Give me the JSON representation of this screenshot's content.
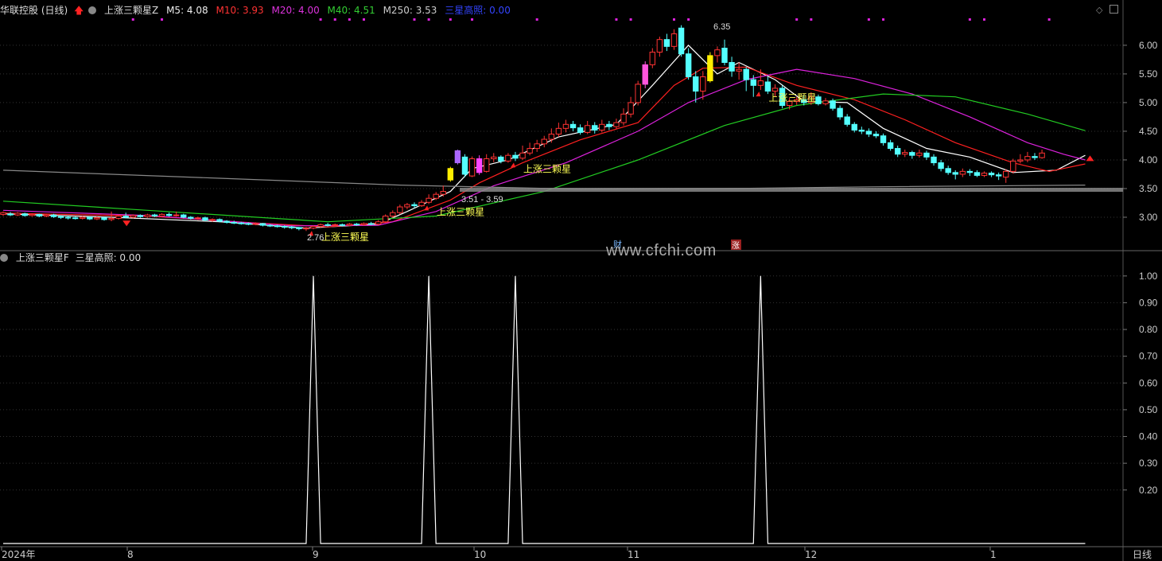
{
  "header_main": {
    "stock": "华联控股 (日线)",
    "indicator": "上涨三颗星Z",
    "m5": "M5: 4.08",
    "m10": "M10: 3.93",
    "m20": "M20: 4.00",
    "m40": "M40: 4.51",
    "m250": "M250: 3.53",
    "signal": "三星高照: 0.00"
  },
  "header_sub": {
    "indicator": "上涨三颗星F",
    "value": "三星高照: 0.00"
  },
  "watermark": "www.cfchi.com",
  "colors": {
    "up": "#ff3333",
    "down": "#54ffff",
    "m5": "#ffffff",
    "m10": "#ff2020",
    "m20": "#dd22dd",
    "m40": "#22cc22",
    "m250": "#888888",
    "label": "#ffff55"
  },
  "chart_data": {
    "type": "candlestick",
    "price_axis": {
      "ticks": [
        "6.00",
        "5.50",
        "5.00",
        "4.50",
        "4.00",
        "3.50",
        "3.00"
      ],
      "ylim": [
        2.5,
        6.5
      ]
    },
    "time_axis": {
      "labels": [
        "2024年",
        "8",
        "9",
        "10",
        "11",
        "12",
        "1"
      ],
      "period": "日线"
    },
    "annotations": {
      "high": "6.35",
      "low": "2.76",
      "range": "3.51 - 3.59",
      "signal_label": "上涨三颗星",
      "badge_cai": "财",
      "badge_zhang": "涨"
    },
    "candles": [
      [
        3.05,
        3.08,
        3.02,
        3.1
      ],
      [
        3.06,
        3.04,
        3.02,
        3.09
      ],
      [
        3.04,
        3.07,
        3.02,
        3.09
      ],
      [
        3.06,
        3.03,
        3.01,
        3.08
      ],
      [
        3.03,
        3.05,
        3.01,
        3.07
      ],
      [
        3.05,
        3.02,
        3.0,
        3.06
      ],
      [
        3.02,
        3.04,
        3.0,
        3.06
      ],
      [
        3.04,
        3.01,
        2.99,
        3.06
      ],
      [
        3.01,
        3.0,
        2.97,
        3.03
      ],
      [
        3.0,
        2.99,
        2.96,
        3.02
      ],
      [
        2.99,
        2.98,
        2.96,
        3.01
      ],
      [
        2.98,
        3.0,
        2.96,
        3.02
      ],
      [
        3.0,
        2.97,
        2.95,
        3.01
      ],
      [
        2.97,
        2.99,
        2.95,
        3.01
      ],
      [
        2.99,
        2.96,
        2.94,
        3.0
      ],
      [
        2.96,
        2.98,
        2.93,
        3.1
      ],
      [
        2.98,
        3.02,
        2.96,
        3.05
      ],
      [
        3.02,
        3.0,
        2.98,
        3.08
      ],
      [
        3.0,
        3.03,
        2.98,
        3.05
      ],
      [
        3.03,
        3.01,
        2.99,
        3.05
      ],
      [
        3.01,
        3.04,
        2.99,
        3.06
      ],
      [
        3.04,
        3.02,
        3.0,
        3.06
      ],
      [
        3.02,
        3.05,
        3.0,
        3.07
      ],
      [
        3.05,
        3.03,
        3.01,
        3.08
      ],
      [
        3.03,
        3.04,
        3.01,
        3.1
      ],
      [
        3.04,
        3.0,
        2.98,
        3.06
      ],
      [
        3.0,
        2.98,
        2.96,
        3.02
      ],
      [
        2.98,
        2.99,
        2.95,
        3.01
      ],
      [
        2.99,
        2.95,
        2.93,
        3.01
      ],
      [
        2.95,
        2.96,
        2.92,
        2.98
      ],
      [
        2.96,
        2.93,
        2.91,
        2.98
      ],
      [
        2.93,
        2.91,
        2.89,
        2.95
      ],
      [
        2.91,
        2.9,
        2.88,
        2.94
      ],
      [
        2.9,
        2.89,
        2.87,
        2.92
      ],
      [
        2.89,
        2.88,
        2.86,
        2.91
      ],
      [
        2.88,
        2.89,
        2.86,
        2.91
      ],
      [
        2.89,
        2.86,
        2.84,
        2.9
      ],
      [
        2.86,
        2.85,
        2.83,
        2.88
      ],
      [
        2.85,
        2.84,
        2.82,
        2.87
      ],
      [
        2.84,
        2.83,
        2.8,
        2.86
      ],
      [
        2.83,
        2.82,
        2.79,
        2.85
      ],
      [
        2.82,
        2.8,
        2.77,
        2.83
      ],
      [
        2.8,
        2.81,
        2.76,
        2.83
      ],
      [
        2.81,
        2.84,
        2.79,
        2.86
      ],
      [
        2.84,
        2.87,
        2.82,
        2.89
      ],
      [
        2.87,
        2.86,
        2.84,
        2.9
      ],
      [
        2.86,
        2.87,
        2.84,
        2.89
      ],
      [
        2.87,
        2.86,
        2.84,
        2.89
      ],
      [
        2.86,
        2.88,
        2.84,
        2.9
      ],
      [
        2.88,
        2.87,
        2.85,
        2.9
      ],
      [
        2.87,
        2.89,
        2.85,
        2.91
      ],
      [
        2.89,
        2.88,
        2.86,
        2.92
      ],
      [
        2.88,
        2.92,
        2.86,
        2.95
      ],
      [
        2.92,
        3.02,
        2.9,
        3.05
      ],
      [
        3.02,
        3.08,
        2.99,
        3.12
      ],
      [
        3.08,
        3.18,
        3.05,
        3.22
      ],
      [
        3.18,
        3.22,
        3.14,
        3.25
      ],
      [
        3.22,
        3.2,
        3.16,
        3.26
      ],
      [
        3.2,
        3.26,
        3.18,
        3.3
      ],
      [
        3.26,
        3.33,
        3.23,
        3.4
      ],
      [
        3.33,
        3.4,
        3.3,
        3.44
      ],
      [
        3.4,
        3.45,
        3.36,
        3.55
      ],
      [
        3.65,
        3.85,
        3.62,
        3.88
      ],
      [
        3.95,
        4.16,
        3.92,
        4.18
      ],
      [
        4.05,
        3.75,
        3.7,
        4.1
      ],
      [
        3.72,
        4.02,
        3.7,
        4.06
      ],
      [
        4.02,
        3.78,
        3.74,
        4.08
      ],
      [
        3.8,
        4.02,
        3.78,
        4.1
      ],
      [
        4.02,
        4.05,
        3.96,
        4.12
      ],
      [
        4.05,
        3.98,
        3.94,
        4.08
      ],
      [
        3.98,
        4.08,
        3.95,
        4.12
      ],
      [
        4.08,
        4.03,
        3.98,
        4.14
      ],
      [
        4.03,
        4.12,
        4.0,
        4.25
      ],
      [
        4.12,
        4.2,
        4.08,
        4.3
      ],
      [
        4.2,
        4.28,
        4.14,
        4.35
      ],
      [
        4.28,
        4.36,
        4.22,
        4.42
      ],
      [
        4.36,
        4.45,
        4.3,
        4.55
      ],
      [
        4.45,
        4.55,
        4.4,
        4.65
      ],
      [
        4.55,
        4.62,
        4.48,
        4.7
      ],
      [
        4.62,
        4.56,
        4.5,
        4.68
      ],
      [
        4.56,
        4.48,
        4.44,
        4.62
      ],
      [
        4.48,
        4.6,
        4.45,
        4.68
      ],
      [
        4.6,
        4.52,
        4.46,
        4.66
      ],
      [
        4.52,
        4.62,
        4.48,
        4.7
      ],
      [
        4.62,
        4.58,
        4.52,
        4.68
      ],
      [
        4.58,
        4.65,
        4.54,
        4.72
      ],
      [
        4.65,
        4.8,
        4.6,
        4.9
      ],
      [
        4.8,
        5.0,
        4.74,
        5.1
      ],
      [
        5.0,
        5.32,
        4.95,
        5.38
      ],
      [
        5.32,
        5.66,
        5.25,
        5.72
      ],
      [
        5.66,
        5.88,
        5.6,
        5.95
      ],
      [
        5.88,
        6.1,
        5.8,
        6.15
      ],
      [
        6.1,
        5.98,
        5.9,
        6.2
      ],
      [
        5.98,
        6.2,
        5.92,
        6.28
      ],
      [
        6.3,
        5.85,
        5.8,
        6.35
      ],
      [
        5.85,
        5.45,
        5.4,
        5.95
      ],
      [
        5.45,
        5.2,
        5.0,
        5.55
      ],
      [
        5.2,
        5.45,
        5.05,
        5.55
      ],
      [
        5.38,
        5.82,
        5.35,
        5.88
      ],
      [
        5.82,
        5.92,
        5.7,
        5.98
      ],
      [
        5.95,
        5.7,
        5.65,
        6.1
      ],
      [
        5.7,
        5.55,
        5.45,
        5.8
      ],
      [
        5.55,
        5.58,
        5.4,
        5.7
      ],
      [
        5.58,
        5.4,
        5.2,
        5.62
      ],
      [
        5.4,
        5.3,
        5.1,
        5.48
      ],
      [
        5.3,
        5.38,
        5.22,
        5.58
      ],
      [
        5.36,
        5.2,
        5.15,
        5.45
      ],
      [
        5.2,
        5.25,
        5.1,
        5.32
      ],
      [
        5.25,
        4.95,
        4.9,
        5.3
      ],
      [
        4.95,
        5.02,
        4.88,
        5.08
      ],
      [
        5.02,
        5.05,
        4.96,
        5.1
      ],
      [
        5.05,
        5.0,
        4.95,
        5.12
      ],
      [
        5.0,
        5.1,
        4.96,
        5.18
      ],
      [
        5.1,
        4.98,
        4.95,
        5.14
      ],
      [
        4.98,
        5.03,
        4.95,
        5.08
      ],
      [
        5.03,
        4.9,
        4.86,
        5.07
      ],
      [
        4.9,
        4.75,
        4.7,
        4.95
      ],
      [
        4.75,
        4.62,
        4.58,
        4.8
      ],
      [
        4.62,
        4.52,
        4.48,
        4.66
      ],
      [
        4.52,
        4.5,
        4.45,
        4.58
      ],
      [
        4.5,
        4.45,
        4.4,
        4.55
      ],
      [
        4.45,
        4.42,
        4.38,
        4.5
      ],
      [
        4.42,
        4.3,
        4.25,
        4.46
      ],
      [
        4.3,
        4.2,
        4.16,
        4.35
      ],
      [
        4.2,
        4.1,
        4.05,
        4.25
      ],
      [
        4.1,
        4.13,
        4.05,
        4.18
      ],
      [
        4.13,
        4.08,
        4.02,
        4.16
      ],
      [
        4.08,
        4.12,
        4.04,
        4.18
      ],
      [
        4.12,
        4.05,
        4.0,
        4.16
      ],
      [
        4.05,
        3.95,
        3.9,
        4.1
      ],
      [
        3.95,
        3.85,
        3.8,
        4.0
      ],
      [
        3.85,
        3.78,
        3.74,
        3.9
      ],
      [
        3.78,
        3.75,
        3.66,
        3.82
      ],
      [
        3.75,
        3.8,
        3.7,
        3.85
      ],
      [
        3.8,
        3.78,
        3.72,
        3.84
      ],
      [
        3.78,
        3.73,
        3.7,
        3.82
      ],
      [
        3.73,
        3.77,
        3.7,
        3.8
      ],
      [
        3.77,
        3.74,
        3.7,
        3.8
      ],
      [
        3.74,
        3.72,
        3.65,
        3.78
      ],
      [
        3.7,
        3.8,
        3.6,
        3.84
      ],
      [
        3.8,
        3.98,
        3.76,
        4.02
      ],
      [
        3.98,
        4.0,
        3.94,
        4.1
      ],
      [
        4.0,
        4.06,
        3.96,
        4.14
      ],
      [
        4.06,
        4.04,
        4.0,
        4.12
      ],
      [
        4.04,
        4.12,
        4.02,
        4.18
      ]
    ],
    "ma": {
      "M5": {
        "color": "#ffffff",
        "values": [
          [
            0,
            3.06
          ],
          [
            15,
            3.0
          ],
          [
            30,
            2.92
          ],
          [
            42,
            2.81
          ],
          [
            52,
            2.88
          ],
          [
            56,
            3.1
          ],
          [
            62,
            3.45
          ],
          [
            65,
            3.85
          ],
          [
            70,
            4.0
          ],
          [
            77,
            4.4
          ],
          [
            85,
            4.62
          ],
          [
            90,
            5.3
          ],
          [
            95,
            6.0
          ],
          [
            99,
            5.5
          ],
          [
            102,
            5.7
          ],
          [
            107,
            5.4
          ],
          [
            111,
            5.02
          ],
          [
            117,
            5.0
          ],
          [
            122,
            4.55
          ],
          [
            128,
            4.2
          ],
          [
            134,
            4.05
          ],
          [
            140,
            3.78
          ],
          [
            146,
            3.82
          ],
          [
            150,
            4.08
          ]
        ]
      },
      "M10": {
        "color": "#ff2020",
        "values": [
          [
            0,
            3.07
          ],
          [
            20,
            3.02
          ],
          [
            35,
            2.9
          ],
          [
            45,
            2.83
          ],
          [
            54,
            2.92
          ],
          [
            62,
            3.3
          ],
          [
            66,
            3.6
          ],
          [
            72,
            3.95
          ],
          [
            80,
            4.35
          ],
          [
            88,
            4.65
          ],
          [
            93,
            5.3
          ],
          [
            97,
            5.6
          ],
          [
            103,
            5.62
          ],
          [
            110,
            5.3
          ],
          [
            118,
            5.05
          ],
          [
            125,
            4.7
          ],
          [
            132,
            4.3
          ],
          [
            140,
            3.95
          ],
          [
            145,
            3.8
          ],
          [
            150,
            3.93
          ]
        ]
      },
      "M20": {
        "color": "#dd22dd",
        "values": [
          [
            0,
            3.12
          ],
          [
            20,
            3.03
          ],
          [
            40,
            2.85
          ],
          [
            52,
            2.86
          ],
          [
            60,
            3.1
          ],
          [
            68,
            3.55
          ],
          [
            78,
            3.95
          ],
          [
            88,
            4.5
          ],
          [
            95,
            5.0
          ],
          [
            103,
            5.4
          ],
          [
            110,
            5.58
          ],
          [
            118,
            5.42
          ],
          [
            126,
            5.15
          ],
          [
            134,
            4.75
          ],
          [
            142,
            4.3
          ],
          [
            147,
            4.1
          ],
          [
            150,
            4.0
          ]
        ]
      },
      "M40": {
        "color": "#22cc22",
        "values": [
          [
            0,
            3.28
          ],
          [
            20,
            3.12
          ],
          [
            45,
            2.92
          ],
          [
            60,
            3.02
          ],
          [
            75,
            3.45
          ],
          [
            88,
            4.0
          ],
          [
            100,
            4.6
          ],
          [
            110,
            4.95
          ],
          [
            122,
            5.15
          ],
          [
            132,
            5.1
          ],
          [
            142,
            4.8
          ],
          [
            150,
            4.51
          ]
        ]
      },
      "M250": {
        "color": "#888888",
        "values": [
          [
            0,
            3.82
          ],
          [
            30,
            3.68
          ],
          [
            55,
            3.56
          ],
          [
            80,
            3.49
          ],
          [
            100,
            3.5
          ],
          [
            120,
            3.53
          ],
          [
            150,
            3.56
          ]
        ]
      }
    },
    "signal_candles": [
      43,
      59,
      71,
      105
    ],
    "sub_indicator": {
      "name": "三星高照",
      "ylim": [
        0,
        1.05
      ],
      "ticks": [
        "1.00",
        "0.90",
        "0.80",
        "0.70",
        "0.60",
        "0.50",
        "0.40",
        "0.30",
        "0.20"
      ],
      "spikes_at_candles": [
        43,
        59,
        71,
        105
      ],
      "value": 0
    }
  }
}
